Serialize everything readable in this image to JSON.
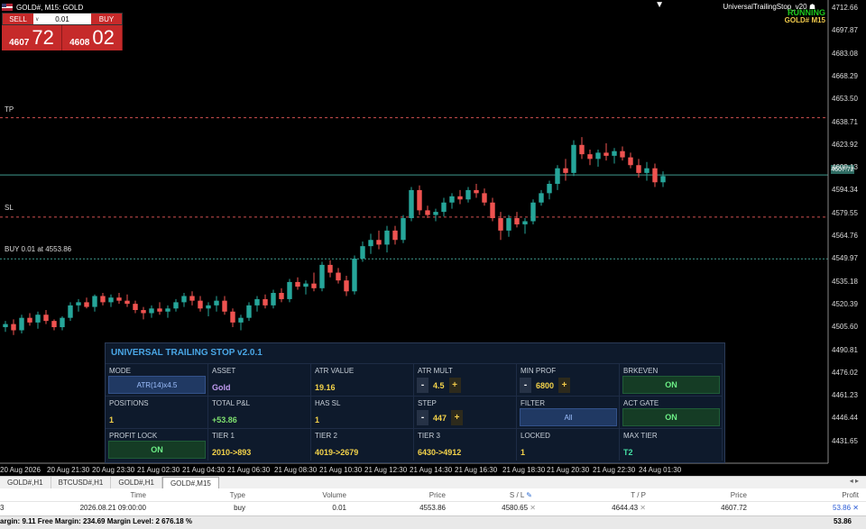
{
  "chart": {
    "symbol_line": "GOLD#, M15:  GOLD",
    "trade": {
      "sell_label": "SELL",
      "buy_label": "BUY",
      "volume": "0.01",
      "sell_small": "4607",
      "sell_big": "72",
      "buy_small": "4608",
      "buy_big": "02"
    },
    "ea": {
      "name": "UniversalTrailingStop_v20",
      "status": "RUNNING",
      "symbol": "GOLD#  M15"
    },
    "levels": {
      "tp": "TP",
      "sl": "SL",
      "buy": "BUY 0.01 at 4553.86",
      "current_tag": "4607.72"
    },
    "y_labels": [
      "4712.66",
      "4697.87",
      "4683.08",
      "4668.29",
      "4653.50",
      "4638.71",
      "4623.92",
      "4609.13",
      "4594.34",
      "4579.55",
      "4564.76",
      "4549.97",
      "4535.18",
      "4520.39",
      "4505.60",
      "4490.81",
      "4476.02",
      "4461.23",
      "4446.44",
      "4431.65"
    ],
    "x_labels": [
      "20 Aug 2026",
      "20 Aug 21:30",
      "20 Aug 23:30",
      "21 Aug 02:30",
      "21 Aug 04:30",
      "21 Aug 06:30",
      "21 Aug 08:30",
      "21 Aug 10:30",
      "21 Aug 12:30",
      "21 Aug 14:30",
      "21 Aug 16:30",
      "21 Aug 18:30",
      "21 Aug 20:30",
      "21 Aug 22:30",
      "24 Aug 01:30"
    ],
    "colors": {
      "bull": "#26a69a",
      "bear": "#ef5350",
      "grid_tp": "#d05050",
      "grid_sl": "#d05050",
      "grid_buy": "#3f9a8e",
      "bid": "#3f9a8e"
    }
  },
  "chart_data": {
    "type": "candlestick",
    "ylim": [
      4425,
      4720
    ],
    "levels": {
      "tp": 4644.43,
      "sl": 4580.65,
      "entry": 4553.86,
      "bid": 4607.72
    },
    "candles": [
      [
        4510,
        4514,
        4507,
        4512
      ],
      [
        4512,
        4515,
        4505,
        4508
      ],
      [
        4508,
        4518,
        4506,
        4516
      ],
      [
        4516,
        4519,
        4511,
        4513
      ],
      [
        4513,
        4520,
        4509,
        4518
      ],
      [
        4518,
        4521,
        4512,
        4514
      ],
      [
        4514,
        4515,
        4508,
        4510
      ],
      [
        4510,
        4517,
        4508,
        4516
      ],
      [
        4516,
        4526,
        4514,
        4524
      ],
      [
        4524,
        4528,
        4520,
        4526
      ],
      [
        4526,
        4529,
        4522,
        4523
      ],
      [
        4523,
        4531,
        4520,
        4530
      ],
      [
        4530,
        4532,
        4524,
        4526
      ],
      [
        4526,
        4531,
        4523,
        4529
      ],
      [
        4529,
        4532,
        4525,
        4527
      ],
      [
        4527,
        4531,
        4523,
        4525
      ],
      [
        4525,
        4527,
        4519,
        4521
      ],
      [
        4521,
        4523,
        4515,
        4519
      ],
      [
        4519,
        4524,
        4516,
        4522
      ],
      [
        4522,
        4526,
        4518,
        4520
      ],
      [
        4520,
        4524,
        4516,
        4522
      ],
      [
        4522,
        4528,
        4520,
        4526
      ],
      [
        4526,
        4532,
        4523,
        4530
      ],
      [
        4530,
        4533,
        4524,
        4527
      ],
      [
        4527,
        4530,
        4520,
        4522
      ],
      [
        4522,
        4526,
        4517,
        4524
      ],
      [
        4524,
        4530,
        4520,
        4527
      ],
      [
        4527,
        4530,
        4518,
        4520
      ],
      [
        4520,
        4522,
        4510,
        4513
      ],
      [
        4513,
        4518,
        4508,
        4516
      ],
      [
        4516,
        4526,
        4514,
        4524
      ],
      [
        4524,
        4530,
        4520,
        4528
      ],
      [
        4528,
        4531,
        4522,
        4524
      ],
      [
        4524,
        4534,
        4522,
        4532
      ],
      [
        4532,
        4535,
        4526,
        4528
      ],
      [
        4528,
        4541,
        4526,
        4539
      ],
      [
        4539,
        4542,
        4534,
        4536
      ],
      [
        4536,
        4540,
        4531,
        4538
      ],
      [
        4538,
        4545,
        4533,
        4535
      ],
      [
        4535,
        4552,
        4533,
        4550
      ],
      [
        4550,
        4553,
        4542,
        4545
      ],
      [
        4545,
        4548,
        4538,
        4540
      ],
      [
        4540,
        4543,
        4530,
        4533
      ],
      [
        4533,
        4556,
        4531,
        4554
      ],
      [
        4554,
        4565,
        4552,
        4562
      ],
      [
        4562,
        4570,
        4557,
        4566
      ],
      [
        4566,
        4572,
        4560,
        4563
      ],
      [
        4563,
        4575,
        4558,
        4572
      ],
      [
        4572,
        4575,
        4563,
        4566
      ],
      [
        4566,
        4582,
        4564,
        4580
      ],
      [
        4580,
        4600,
        4578,
        4598
      ],
      [
        4598,
        4601,
        4582,
        4585
      ],
      [
        4585,
        4588,
        4580,
        4582
      ],
      [
        4582,
        4586,
        4578,
        4584
      ],
      [
        4584,
        4593,
        4581,
        4590
      ],
      [
        4590,
        4596,
        4586,
        4594
      ],
      [
        4594,
        4598,
        4589,
        4592
      ],
      [
        4592,
        4600,
        4590,
        4598
      ],
      [
        4598,
        4602,
        4593,
        4596
      ],
      [
        4596,
        4599,
        4588,
        4590
      ],
      [
        4590,
        4593,
        4578,
        4580
      ],
      [
        4580,
        4584,
        4566,
        4572
      ],
      [
        4572,
        4582,
        4568,
        4580
      ],
      [
        4580,
        4584,
        4574,
        4576
      ],
      [
        4576,
        4580,
        4570,
        4578
      ],
      [
        4578,
        4592,
        4576,
        4590
      ],
      [
        4590,
        4598,
        4588,
        4596
      ],
      [
        4596,
        4604,
        4592,
        4602
      ],
      [
        4602,
        4614,
        4598,
        4612
      ],
      [
        4612,
        4618,
        4604,
        4609
      ],
      [
        4609,
        4630,
        4607,
        4627
      ],
      [
        4627,
        4632,
        4618,
        4621
      ],
      [
        4621,
        4624,
        4614,
        4618
      ],
      [
        4618,
        4624,
        4613,
        4622
      ],
      [
        4622,
        4628,
        4617,
        4620
      ],
      [
        4620,
        4625,
        4615,
        4623
      ],
      [
        4623,
        4626,
        4617,
        4619
      ],
      [
        4619,
        4622,
        4612,
        4614
      ],
      [
        4614,
        4618,
        4606,
        4609
      ],
      [
        4609,
        4616,
        4604,
        4612
      ],
      [
        4612,
        4615,
        4600,
        4603
      ],
      [
        4603,
        4610,
        4600,
        4607
      ]
    ]
  },
  "panel": {
    "title": "UNIVERSAL TRAILING STOP  v2.0.1",
    "mode": {
      "label": "MODE",
      "value": "ATR(14)x4.5"
    },
    "asset": {
      "label": "ASSET",
      "value": "Gold"
    },
    "atr_value": {
      "label": "ATR VALUE",
      "value": "19.16"
    },
    "atr_mult": {
      "label": "ATR MULT",
      "minus": "-",
      "value": "4.5",
      "plus": "+"
    },
    "min_prof": {
      "label": "MIN PROF",
      "minus": "-",
      "value": "6800",
      "plus": "+"
    },
    "brkeven": {
      "label": "BRKEVEN",
      "value": "ON"
    },
    "positions": {
      "label": "POSITIONS",
      "value": "1"
    },
    "total_pnl": {
      "label": "TOTAL P&L",
      "value": "+53.86"
    },
    "has_sl": {
      "label": "HAS SL",
      "value": "1"
    },
    "step": {
      "label": "STEP",
      "minus": "-",
      "value": "447",
      "plus": "+"
    },
    "filter": {
      "label": "FILTER",
      "value": "All"
    },
    "act_gate": {
      "label": "ACT GATE",
      "value": "ON"
    },
    "profit_lock": {
      "label": "PROFIT LOCK",
      "value": "ON"
    },
    "tier1": {
      "label": "TIER 1",
      "value": "2010->893"
    },
    "tier2": {
      "label": "TIER 2",
      "value": "4019->2679"
    },
    "tier3": {
      "label": "TIER 3",
      "value": "6430->4912"
    },
    "locked": {
      "label": "LOCKED",
      "value": "1"
    },
    "max_tier": {
      "label": "MAX TIER",
      "value": "T2"
    }
  },
  "tabs": [
    "GOLD#,H1",
    "BTCUSD#,H1",
    "GOLD#,H1",
    "GOLD#,M15"
  ],
  "terminal": {
    "headers": {
      "time": "Time",
      "type": "Type",
      "volume": "Volume",
      "price": "Price",
      "sl": "S / L",
      "tp": "T / P",
      "cur_price": "Price",
      "profit": "Profit"
    },
    "row": {
      "id": "3",
      "time": "2026.08.21 09:00:00",
      "type": "buy",
      "volume": "0.01",
      "price": "4553.86",
      "sl": "4580.65",
      "tp": "4644.43",
      "cur_price": "4607.72",
      "profit": "53.86"
    }
  },
  "statusbar": {
    "text": "argin: 9.11  Free Margin: 234.69  Margin Level: 2 676.18 %",
    "profit": "53.86"
  }
}
